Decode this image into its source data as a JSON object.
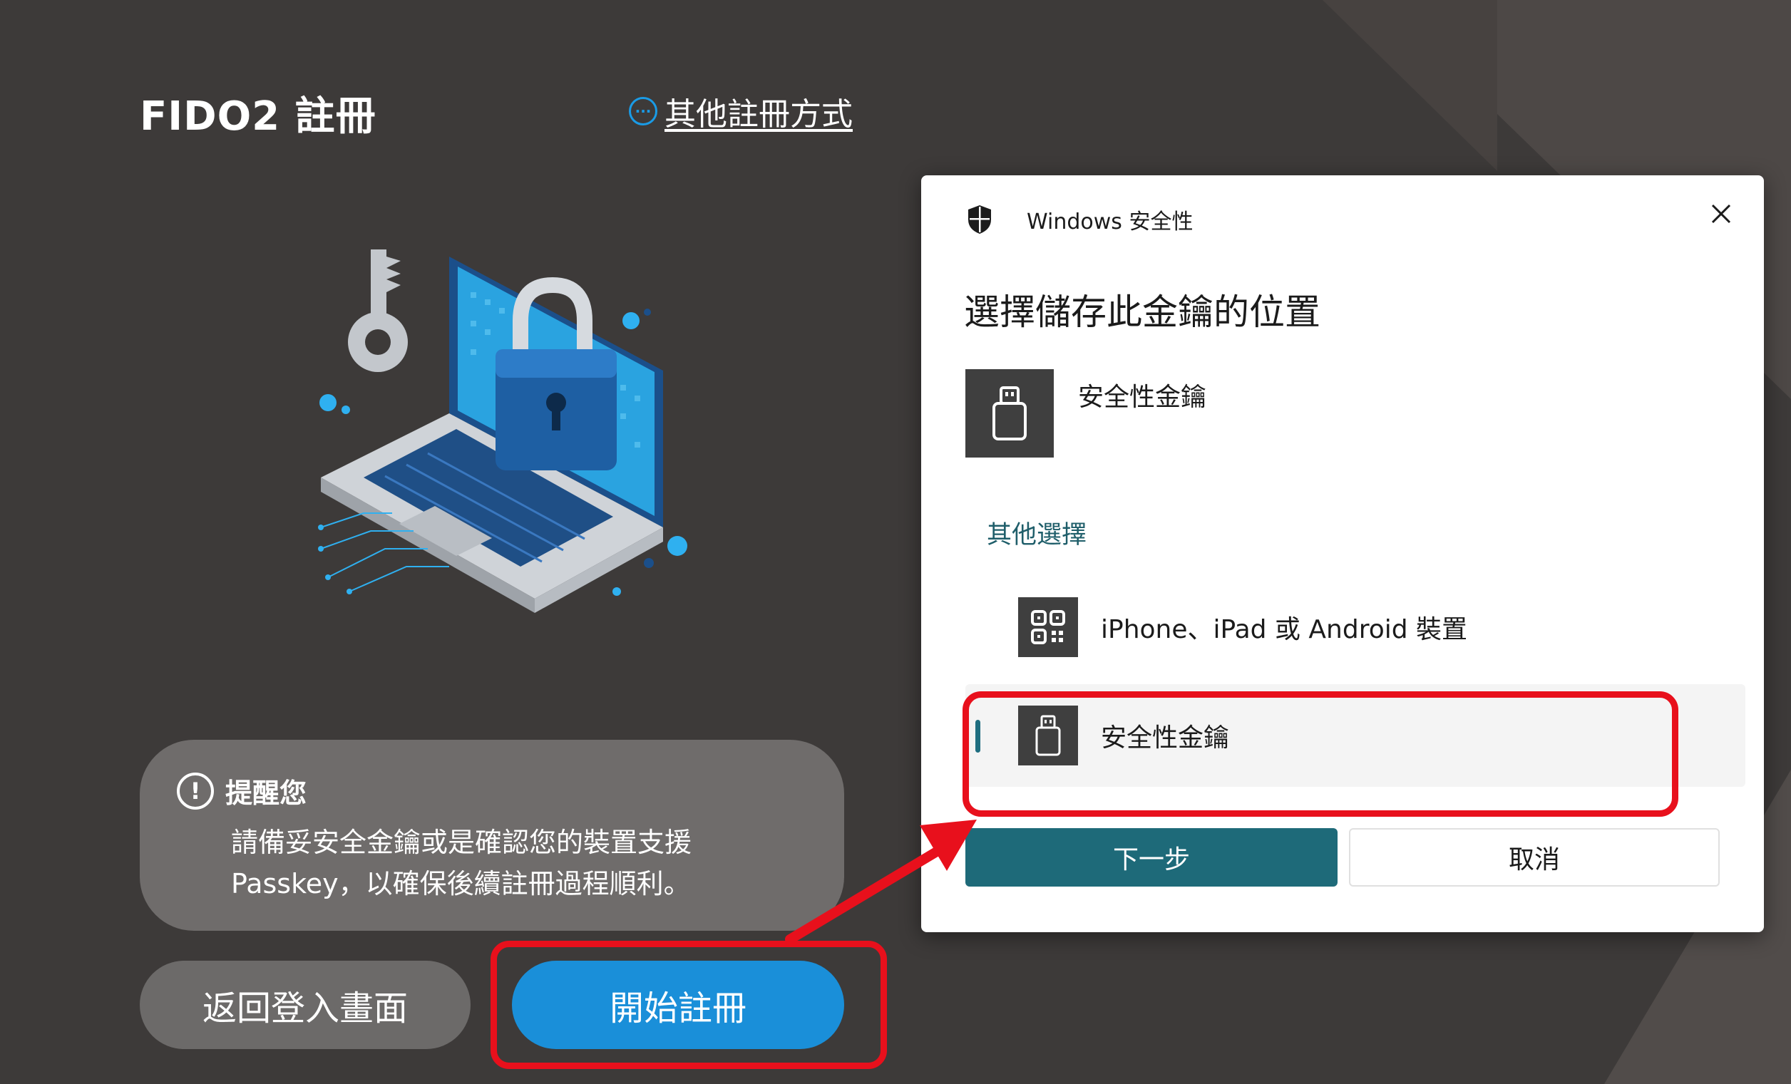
{
  "page": {
    "title": "FIDO2 註冊",
    "other_methods_link": "其他註冊方式",
    "other_methods_icon": "more-dots-icon"
  },
  "notice": {
    "icon": "info-icon",
    "title": "提醒您",
    "body": "請備妥安全金鑰或是確認您的裝置支援 Passkey，以確保後續註冊過程順利。"
  },
  "buttons": {
    "back": "返回登入畫面",
    "start": "開始註冊"
  },
  "dialog": {
    "app_title": "Windows 安全性",
    "heading": "選擇儲存此金鑰的位置",
    "primary_option": "安全性金鑰",
    "other_options_label": "其他選擇",
    "options": [
      {
        "label": "iPhone、iPad 或 Android 裝置",
        "icon": "qr-code-icon",
        "selected": false
      },
      {
        "label": "安全性金鑰",
        "icon": "usb-key-icon",
        "selected": true
      }
    ],
    "next": "下一步",
    "cancel": "取消"
  },
  "colors": {
    "background": "#3d3a39",
    "primary_blue": "#1a8fd9",
    "dialog_accent": "#1e6a79",
    "highlight_red": "#e8101c"
  }
}
